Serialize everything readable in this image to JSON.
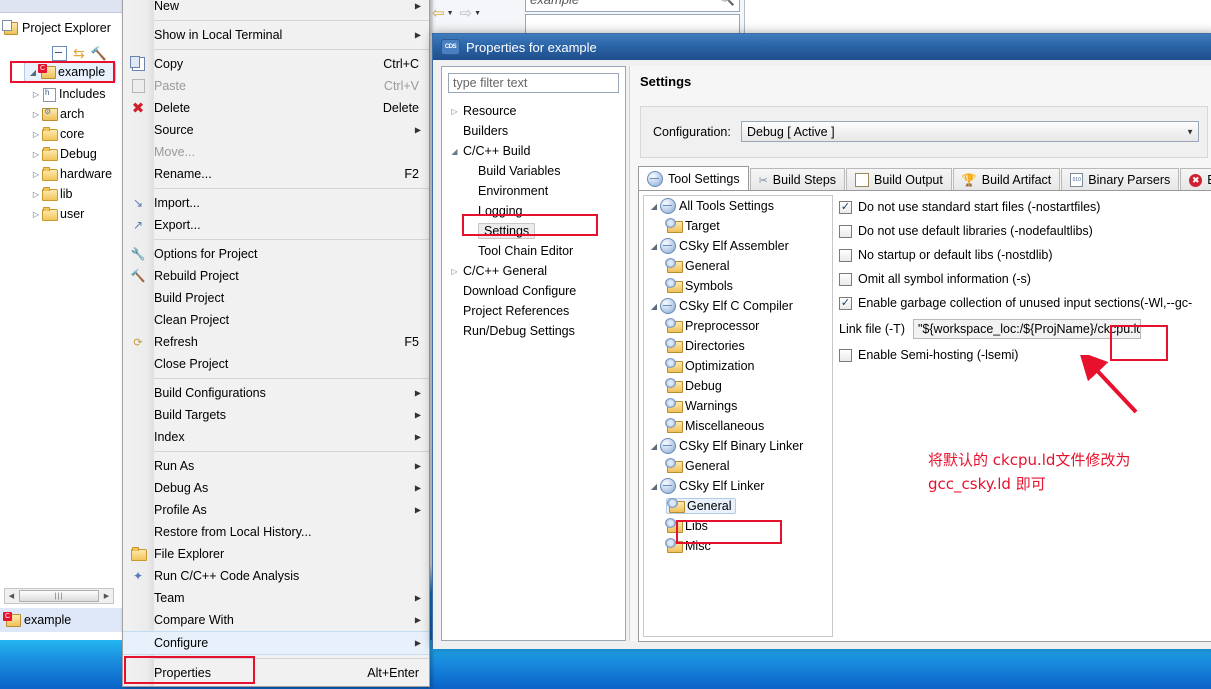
{
  "explorer": {
    "title": "Project Explorer",
    "toolbar_icons": [
      "collapse-all-icon",
      "link-with-editor-icon",
      "build-hammer-icon"
    ],
    "root": {
      "label": "example",
      "icon": "c-project-icon",
      "twisty": "◢"
    },
    "children": [
      {
        "label": "Includes",
        "icon": "includes-icon"
      },
      {
        "label": "arch",
        "icon": "folder-link-icon"
      },
      {
        "label": "core",
        "icon": "folder-icon"
      },
      {
        "label": "Debug",
        "icon": "folder-icon"
      },
      {
        "label": "hardware",
        "icon": "folder-icon"
      },
      {
        "label": "lib",
        "icon": "folder-icon"
      },
      {
        "label": "user",
        "icon": "folder-icon"
      }
    ],
    "status_item": "example"
  },
  "background_window": {
    "search_value": "example",
    "back_icon": "back-arrow-icon",
    "forward_icon": "forward-arrow-icon",
    "search_icon": "search-icon"
  },
  "context_menu": {
    "items": [
      {
        "label": "New",
        "accel": "",
        "submenu": true,
        "icon": "",
        "disabled": false
      },
      {
        "sep": true
      },
      {
        "label": "Show in Local Terminal",
        "accel": "",
        "submenu": true,
        "icon": "",
        "disabled": false
      },
      {
        "sep": true
      },
      {
        "label": "Copy",
        "accel": "Ctrl+C",
        "submenu": false,
        "icon": "copy-icon",
        "disabled": false
      },
      {
        "label": "Paste",
        "accel": "Ctrl+V",
        "submenu": false,
        "icon": "paste-icon",
        "disabled": true
      },
      {
        "label": "Delete",
        "accel": "Delete",
        "submenu": false,
        "icon": "delete-x-icon",
        "disabled": false
      },
      {
        "label": "Source",
        "accel": "",
        "submenu": true,
        "icon": "",
        "disabled": false
      },
      {
        "label": "Move...",
        "accel": "",
        "submenu": false,
        "icon": "",
        "disabled": true
      },
      {
        "label": "Rename...",
        "accel": "F2",
        "submenu": false,
        "icon": "",
        "disabled": false
      },
      {
        "sep": true
      },
      {
        "label": "Import...",
        "accel": "",
        "submenu": false,
        "icon": "import-icon",
        "disabled": false
      },
      {
        "label": "Export...",
        "accel": "",
        "submenu": false,
        "icon": "export-icon",
        "disabled": false
      },
      {
        "sep": true
      },
      {
        "label": "Options for Project",
        "accel": "",
        "submenu": false,
        "icon": "options-icon",
        "disabled": false
      },
      {
        "label": "Rebuild Project",
        "accel": "",
        "submenu": false,
        "icon": "rebuild-icon",
        "disabled": false
      },
      {
        "label": "Build Project",
        "accel": "",
        "submenu": false,
        "icon": "",
        "disabled": false
      },
      {
        "label": "Clean Project",
        "accel": "",
        "submenu": false,
        "icon": "",
        "disabled": false
      },
      {
        "label": "Refresh",
        "accel": "F5",
        "submenu": false,
        "icon": "refresh-icon",
        "disabled": false
      },
      {
        "label": "Close Project",
        "accel": "",
        "submenu": false,
        "icon": "",
        "disabled": false
      },
      {
        "sep": true
      },
      {
        "label": "Build Configurations",
        "accel": "",
        "submenu": true,
        "icon": "",
        "disabled": false
      },
      {
        "label": "Build Targets",
        "accel": "",
        "submenu": true,
        "icon": "",
        "disabled": false
      },
      {
        "label": "Index",
        "accel": "",
        "submenu": true,
        "icon": "",
        "disabled": false
      },
      {
        "sep": true
      },
      {
        "label": "Run As",
        "accel": "",
        "submenu": true,
        "icon": "",
        "disabled": false
      },
      {
        "label": "Debug As",
        "accel": "",
        "submenu": true,
        "icon": "",
        "disabled": false
      },
      {
        "label": "Profile As",
        "accel": "",
        "submenu": true,
        "icon": "",
        "disabled": false
      },
      {
        "label": "Restore from Local History...",
        "accel": "",
        "submenu": false,
        "icon": "",
        "disabled": false
      },
      {
        "label": "File Explorer",
        "accel": "",
        "submenu": false,
        "icon": "folder-open-icon",
        "disabled": false
      },
      {
        "label": "Run C/C++ Code Analysis",
        "accel": "",
        "submenu": false,
        "icon": "code-analysis-icon",
        "disabled": false
      },
      {
        "label": "Team",
        "accel": "",
        "submenu": true,
        "icon": "",
        "disabled": false
      },
      {
        "label": "Compare With",
        "accel": "",
        "submenu": true,
        "icon": "",
        "disabled": false
      },
      {
        "label": "Configure",
        "accel": "",
        "submenu": true,
        "icon": "",
        "disabled": false,
        "highlight": true
      },
      {
        "sep": true
      },
      {
        "label": "Properties",
        "accel": "Alt+Enter",
        "submenu": false,
        "icon": "",
        "disabled": false
      }
    ]
  },
  "dialog": {
    "title": "Properties for example",
    "icon": "cdt-project-icon",
    "filter_placeholder": "type filter text",
    "nav_tree": [
      {
        "label": "Resource",
        "twisty": "▷",
        "indent": 0,
        "selected": false
      },
      {
        "label": "Builders",
        "twisty": "",
        "indent": 0,
        "selected": false
      },
      {
        "label": "C/C++ Build",
        "twisty": "◢",
        "indent": 0,
        "selected": false
      },
      {
        "label": "Build Variables",
        "twisty": "",
        "indent": 1,
        "selected": false
      },
      {
        "label": "Environment",
        "twisty": "",
        "indent": 1,
        "selected": false
      },
      {
        "label": "Logging",
        "twisty": "",
        "indent": 1,
        "selected": false
      },
      {
        "label": "Settings",
        "twisty": "",
        "indent": 1,
        "selected": true
      },
      {
        "label": "Tool Chain Editor",
        "twisty": "",
        "indent": 1,
        "selected": false
      },
      {
        "label": "C/C++ General",
        "twisty": "▷",
        "indent": 0,
        "selected": false
      },
      {
        "label": "Download Configure",
        "twisty": "",
        "indent": 0,
        "selected": false
      },
      {
        "label": "Project References",
        "twisty": "",
        "indent": 0,
        "selected": false
      },
      {
        "label": "Run/Debug Settings",
        "twisty": "",
        "indent": 0,
        "selected": false
      }
    ],
    "page_title": "Settings",
    "configuration_label": "Configuration:",
    "configuration_value": "Debug  [ Active ]",
    "tabs": [
      {
        "label": "Tool Settings",
        "icon": "tool-settings-icon",
        "active": true
      },
      {
        "label": "Build Steps",
        "icon": "build-steps-icon",
        "active": false
      },
      {
        "label": "Build Output",
        "icon": "build-output-icon",
        "active": false
      },
      {
        "label": "Build Artifact",
        "icon": "build-artifact-icon",
        "active": false
      },
      {
        "label": "Binary Parsers",
        "icon": "binary-parsers-icon",
        "active": false
      },
      {
        "label": "E",
        "icon": "error-parsers-icon",
        "active": false
      }
    ],
    "tools_tree": [
      {
        "label": "All Tools Settings",
        "type": "group",
        "twisty": "◢",
        "selected": false
      },
      {
        "label": "Target",
        "type": "leaf",
        "twisty": "",
        "selected": false
      },
      {
        "label": "CSky Elf Assembler",
        "type": "group",
        "twisty": "◢",
        "selected": false
      },
      {
        "label": "General",
        "type": "leaf",
        "twisty": "",
        "selected": false
      },
      {
        "label": "Symbols",
        "type": "leaf",
        "twisty": "",
        "selected": false
      },
      {
        "label": "CSky Elf C Compiler",
        "type": "group",
        "twisty": "◢",
        "selected": false
      },
      {
        "label": "Preprocessor",
        "type": "leaf",
        "twisty": "",
        "selected": false
      },
      {
        "label": "Directories",
        "type": "leaf",
        "twisty": "",
        "selected": false
      },
      {
        "label": "Optimization",
        "type": "leaf",
        "twisty": "",
        "selected": false
      },
      {
        "label": "Debug",
        "type": "leaf",
        "twisty": "",
        "selected": false
      },
      {
        "label": "Warnings",
        "type": "leaf",
        "twisty": "",
        "selected": false
      },
      {
        "label": "Miscellaneous",
        "type": "leaf",
        "twisty": "",
        "selected": false
      },
      {
        "label": "CSky Elf Binary Linker",
        "type": "group",
        "twisty": "◢",
        "selected": false
      },
      {
        "label": "General",
        "type": "leaf",
        "twisty": "",
        "selected": false
      },
      {
        "label": "CSky Elf Linker",
        "type": "group",
        "twisty": "◢",
        "selected": false
      },
      {
        "label": "General",
        "type": "leaf",
        "twisty": "",
        "selected": true
      },
      {
        "label": "Libs",
        "type": "leaf",
        "twisty": "",
        "selected": false
      },
      {
        "label": "Misc",
        "type": "leaf",
        "twisty": "",
        "selected": false
      }
    ],
    "options": [
      {
        "label": "Do not use standard start files (-nostartfiles)",
        "checked": true
      },
      {
        "label": "Do not use default libraries (-nodefaultlibs)",
        "checked": false
      },
      {
        "label": "No startup or default libs (-nostdlib)",
        "checked": false
      },
      {
        "label": "Omit all symbol information (-s)",
        "checked": false
      },
      {
        "label": "Enable garbage collection of unused input sections(-Wl,--gc-",
        "checked": true
      }
    ],
    "link_file_label": "Link file (-T)",
    "link_file_value": "\"${workspace_loc:/${ProjName}/ckcpu.ld}\"",
    "semi_hosting": {
      "label": "Enable Semi-hosting (-lsemi)",
      "checked": false
    }
  },
  "annotation": {
    "color": "#e8112d",
    "text": "将默认的 ckcpu.ld文件修改为\ngcc_csky.ld 即可",
    "arrow_icon": "red-arrow-icon",
    "highlight_boxes": [
      "project-root-highlight",
      "settings-node-highlight",
      "linker-general-highlight",
      "link-file-value-highlight",
      "properties-menu-highlight"
    ]
  }
}
